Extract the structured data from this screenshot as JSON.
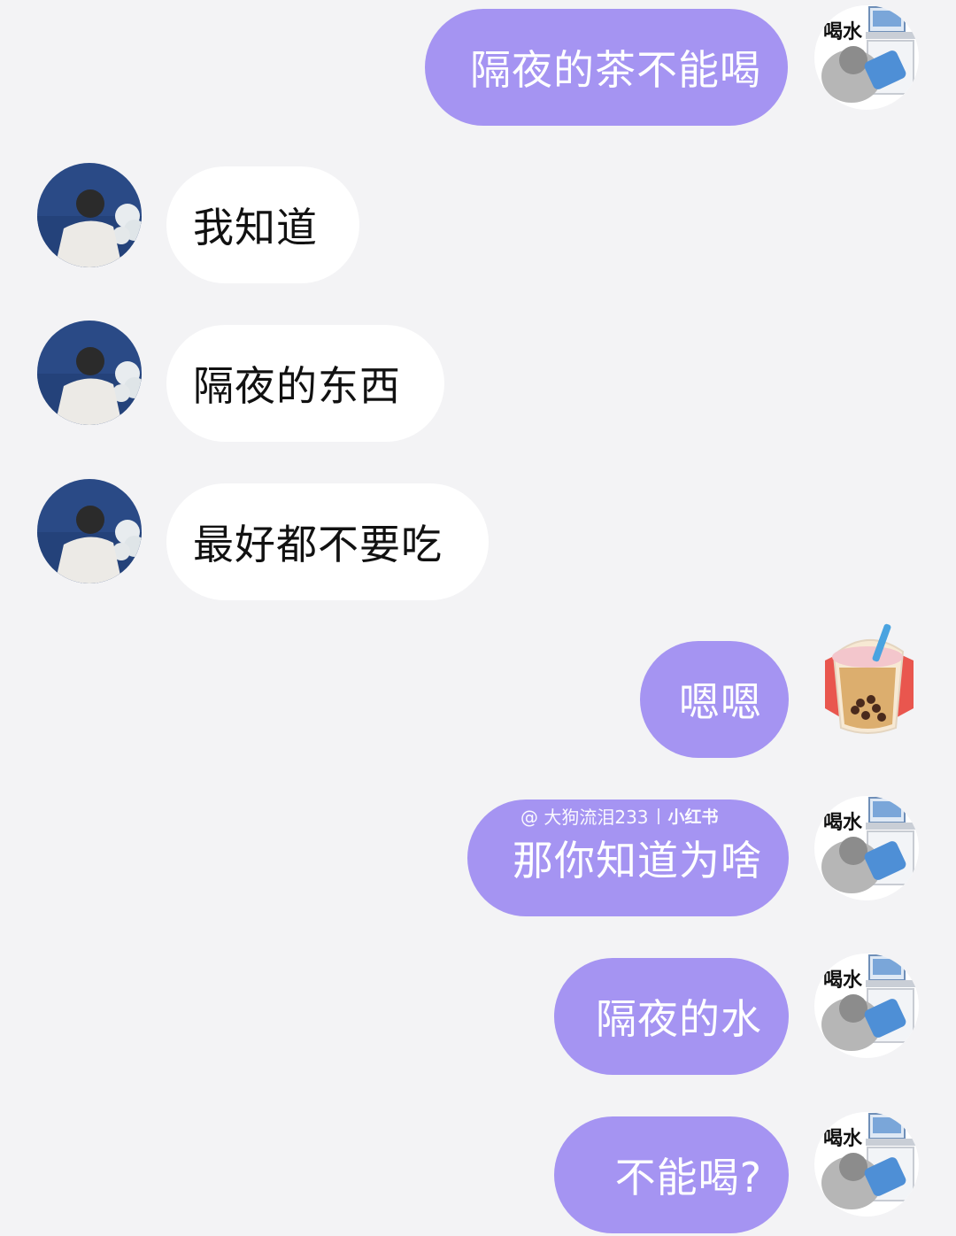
{
  "colors": {
    "background": "#f3f3f5",
    "sent_bubble": "#a594f2",
    "received_bubble": "#ffffff",
    "sent_text": "#ffffff",
    "received_text": "#111111"
  },
  "messages": [
    {
      "side": "sent",
      "text": "隔夜的茶不能喝",
      "avatar": "water-sticker-avatar"
    },
    {
      "side": "received",
      "text": "我知道",
      "avatar": "contact-avatar"
    },
    {
      "side": "received",
      "text": "隔夜的东西",
      "avatar": "contact-avatar"
    },
    {
      "side": "received",
      "text": "最好都不要吃",
      "avatar": "contact-avatar"
    },
    {
      "side": "sent",
      "text": "嗯嗯",
      "avatar": "bubble-tea-avatar"
    },
    {
      "side": "sent",
      "text": "那你知道为啥",
      "avatar": "water-sticker-avatar"
    },
    {
      "side": "sent",
      "text": "隔夜的水",
      "avatar": "water-sticker-avatar"
    },
    {
      "side": "sent",
      "text": "不能喝?",
      "avatar": "water-sticker-avatar"
    }
  ],
  "sticker_label": "喝水",
  "watermark": {
    "handle": "@ 大狗流泪233",
    "brand": "小红书"
  }
}
